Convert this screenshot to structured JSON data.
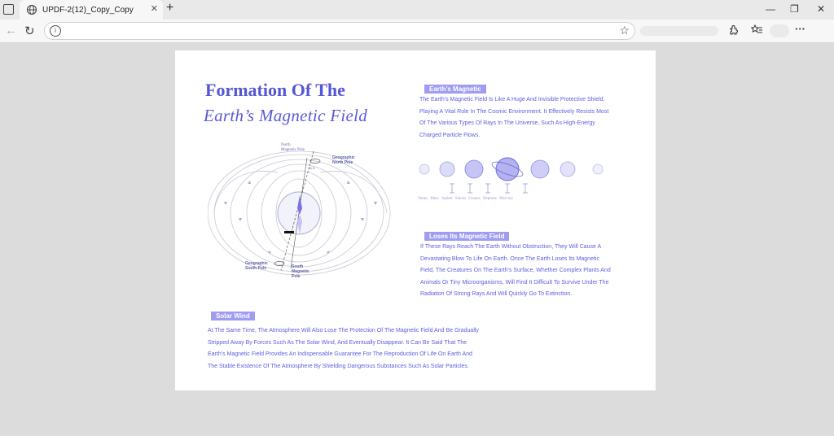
{
  "browser": {
    "tab_title": "UPDF-2(12)_Copy_Copy",
    "tab_close": "✕",
    "new_tab": "+",
    "win_minimize": "—",
    "win_restore": "❐",
    "win_close": "✕",
    "back": "←",
    "reload": "↻",
    "address": "",
    "more": "···"
  },
  "document": {
    "title_line1": "Formation Of The",
    "title_line2": "Earth’s  Magnetic Field",
    "diagram": {
      "north_magnetic_pole": [
        "North",
        "Magnetic Pole"
      ],
      "geographic_north_pole": [
        "Geographic",
        "North Pole"
      ],
      "geographic_south_pole": [
        "Geographic",
        "South Pole"
      ],
      "south_magnetic_pole": [
        "South",
        "Magnetic",
        "Pole"
      ],
      "angle": "11.5"
    },
    "section1": {
      "heading": "Earth’s Magnetic",
      "lines": [
        "The Earth's Magnetic Field Is Like A Huge And Invisible Protective Shield,",
        "Playing A Vital Role In The Cosmic Environment. It Effectively Resists Most",
        "Of The Various Types Of Rays In The Universe, Such As High-Energy",
        "Charged Particle Flows."
      ]
    },
    "planets": [
      "Venus",
      "Mars",
      "Jupiter",
      "Saturn",
      "Uranus",
      "Neptune",
      "Mercury"
    ],
    "section2": {
      "heading": "Loses Its Magnetic Field",
      "lines": [
        "If These Rays Reach The Earth Without Obstruction, They Will Cause A",
        "Devastating Blow To Life On Earth. Once The Earth Loses Its Magnetic",
        "Field, The Creatures On The Earth's Surface, Whether Complex Plants And",
        "Animals Or Tiny Microorganisms, Will Find It Difficult To Survive Under The",
        "Radiation Of Strong Rays And Will Quickly Go To Extinction."
      ]
    },
    "section3": {
      "heading": "Solar Wind",
      "lines": [
        "At The Same Time, The Atmosphere Will Also Lose The Protection Of The Magnetic Field And Be Gradually",
        "Stripped Away By Forces Such As The Solar Wind, And Eventually Disappear. It Can Be Said That The",
        "Earth's Magnetic Field Provides An Indispensable Guarantee For The Reproduction Of Life On Earth And",
        "The Stable Existence Of The Atmosphere By Shielding Dangerous Substances Such As Solar Particles."
      ]
    }
  }
}
